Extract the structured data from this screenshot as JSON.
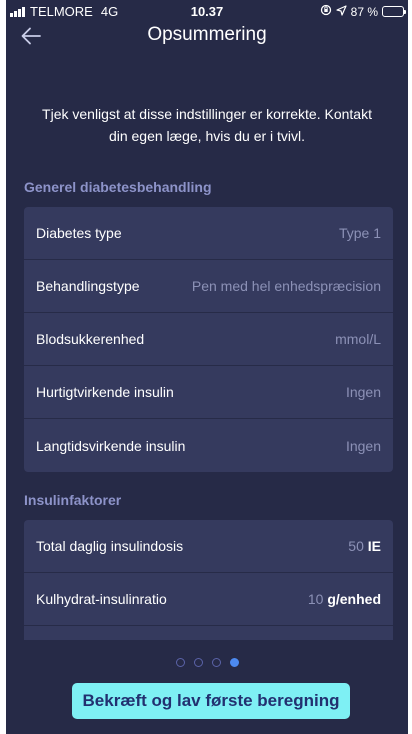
{
  "status_bar": {
    "carrier": "TELMORE",
    "network": "4G",
    "time": "10.37",
    "battery": "87 %",
    "battery_level": 0.87
  },
  "nav": {
    "title": "Opsummering"
  },
  "intro": {
    "line1": "Tjek venligst at disse indstillinger er korrekte. Kontakt",
    "line2": "din egen læge, hvis du er i tvivl."
  },
  "general": {
    "title": "Generel diabetesbehandling",
    "rows": [
      {
        "label": "Diabetes type",
        "value": "Type 1"
      },
      {
        "label": "Behandlingstype",
        "value": "Pen med hel enhedspræcision"
      },
      {
        "label": "Blodsukkerenhed",
        "value": "mmol/L"
      },
      {
        "label": "Hurtigtvirkende insulin",
        "value": "Ingen"
      },
      {
        "label": "Langtidsvirkende insulin",
        "value": "Ingen"
      }
    ]
  },
  "insulin": {
    "title": "Insulinfaktorer",
    "rows": [
      {
        "label": "Total daglig insulindosis",
        "number": "50",
        "unit": "IE"
      },
      {
        "label": "Kulhydrat-insulinratio",
        "number": "10",
        "unit": "g/enhed"
      }
    ]
  },
  "pager": {
    "total": 4,
    "active_index": 3
  },
  "confirm_button": "Bekræft og lav første beregning",
  "colors": {
    "background": "#262a47",
    "card": "#353a5e",
    "section_title": "#8d93c9",
    "button": "#7ef0f4",
    "button_text": "#223070",
    "active_dot": "#4d8af0"
  }
}
